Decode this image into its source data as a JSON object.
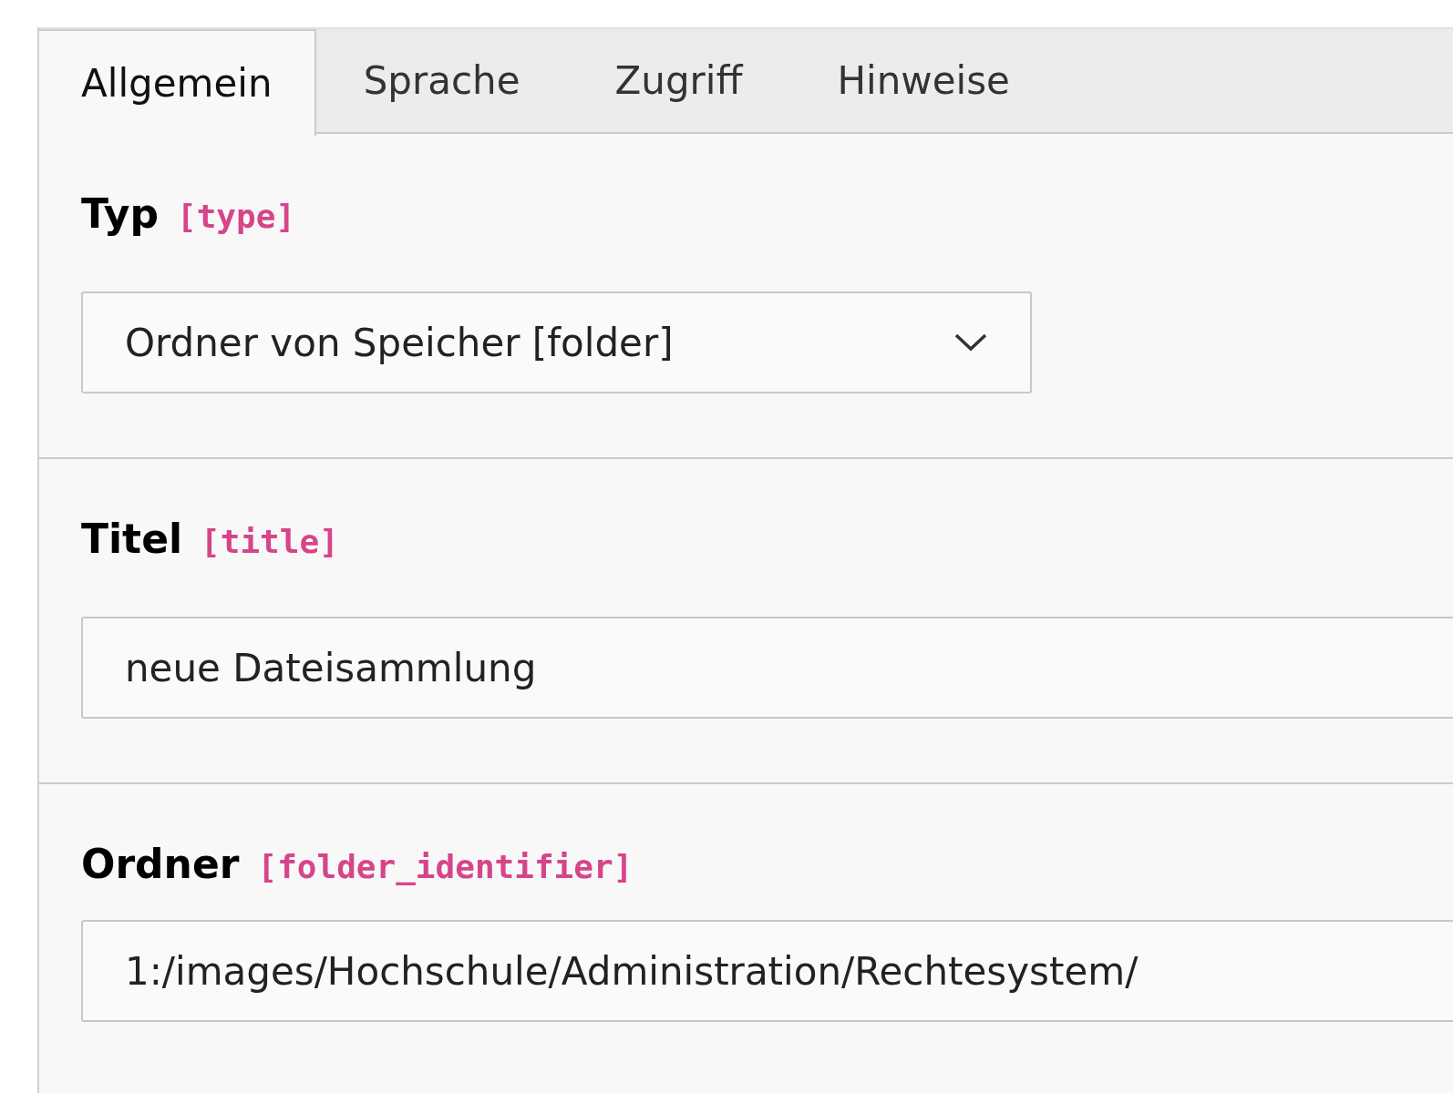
{
  "tabs": [
    {
      "label": "Allgemein",
      "selected": true
    },
    {
      "label": "Sprache",
      "selected": false
    },
    {
      "label": "Zugriff",
      "selected": false
    },
    {
      "label": "Hinweise",
      "selected": false
    }
  ],
  "fields": [
    {
      "kind": "select",
      "label": "Typ",
      "field_name": "[type]",
      "value": "Ordner von Speicher [folder]"
    },
    {
      "kind": "input",
      "label": "Titel",
      "field_name": "[title]",
      "value": "neue Dateisammlung"
    },
    {
      "kind": "input",
      "label": "Ordner",
      "field_name": "[folder_identifier]",
      "value": "1:/images/Hochschule/Administration/Rechtesystem/"
    }
  ]
}
